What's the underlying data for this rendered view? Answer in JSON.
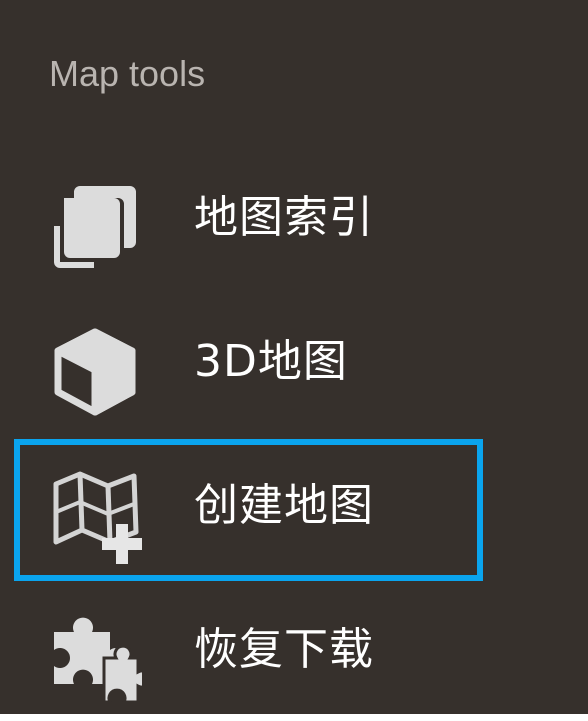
{
  "panel": {
    "title": "Map tools",
    "focused_index": 2,
    "accent_color": "#0aa4ee",
    "background_color": "#36302c"
  },
  "items": [
    {
      "label": "地图索引",
      "icon": "layers-icon"
    },
    {
      "label": "3D地图",
      "icon": "cube-icon"
    },
    {
      "label": "创建地图",
      "icon": "map-add-icon"
    },
    {
      "label": "恢复下载",
      "icon": "puzzle-icon"
    }
  ]
}
